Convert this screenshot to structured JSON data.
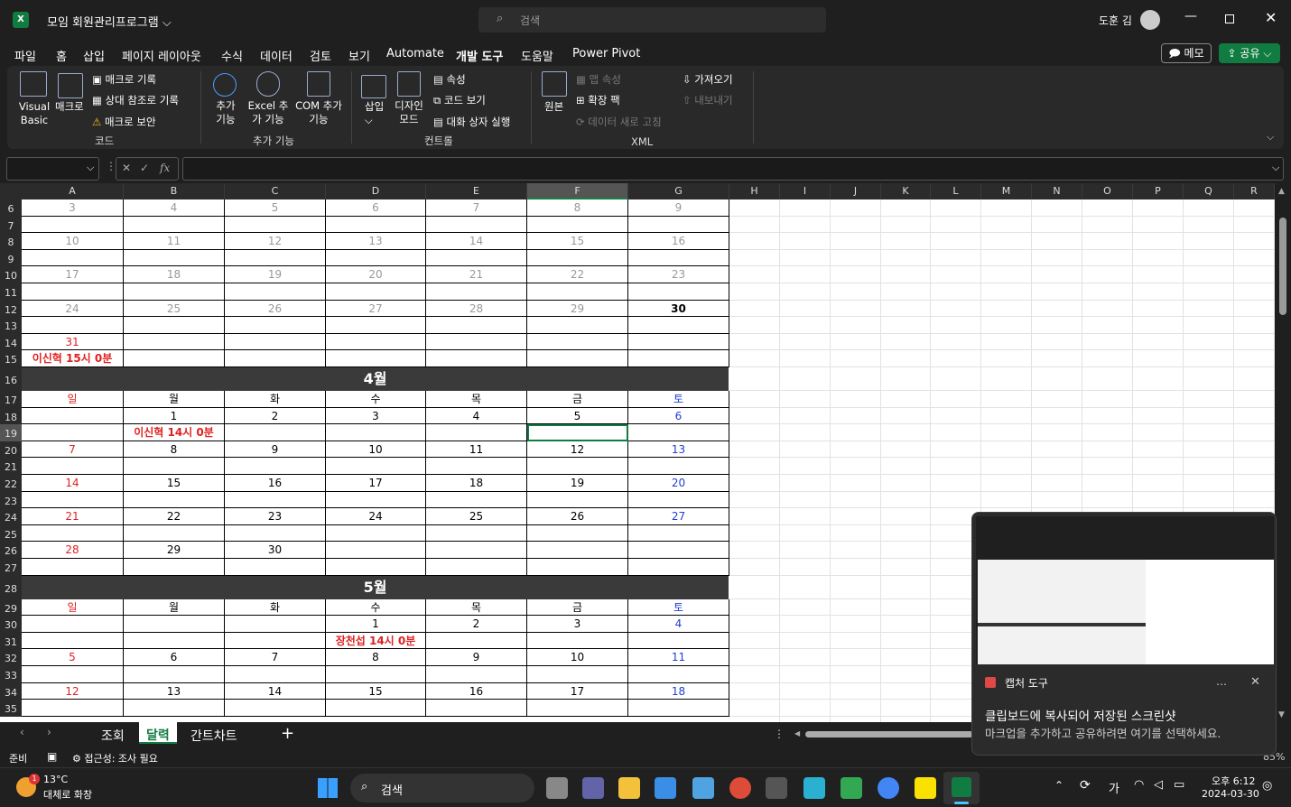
{
  "window": {
    "title": "모임 회원관리프로그램",
    "search_placeholder": "검색",
    "user_name": "도훈 김"
  },
  "menu_tabs": [
    "파일",
    "홈",
    "삽입",
    "페이지 레이아웃",
    "수식",
    "데이터",
    "검토",
    "보기",
    "Automate",
    "개발 도구",
    "도움말",
    "Power Pivot"
  ],
  "active_tab": "개발 도구",
  "memo_button": "메모",
  "share_button": "공유",
  "ribbon": {
    "code": {
      "visual_basic": "Visual Basic",
      "macro": "매크로",
      "record_macro": "매크로 기록",
      "relative_ref": "상대 참조로 기록",
      "macro_security": "매크로 보안",
      "group": "코드"
    },
    "addins": {
      "addin": "추가 기능",
      "excel_addin": "Excel 추가 기능",
      "com_addin": "COM 추가 기능",
      "group": "추가 기능"
    },
    "controls": {
      "insert": "삽입",
      "design_mode": "디자인 모드",
      "properties": "속성",
      "view_code": "코드 보기",
      "run_dialog": "대화 상자 실행",
      "group": "컨트롤"
    },
    "xml": {
      "source": "원본",
      "map_properties": "맵 속성",
      "expansion_packs": "확장 팩",
      "refresh_data": "데이터 새로 고침",
      "import": "가져오기",
      "export": "내보내기",
      "group": "XML"
    }
  },
  "formula_bar": {
    "fx": "fx"
  },
  "columns": [
    "A",
    "B",
    "C",
    "D",
    "E",
    "F",
    "G",
    "H",
    "I",
    "J",
    "K",
    "L",
    "M",
    "N",
    "O",
    "P",
    "Q",
    "R"
  ],
  "rows": [
    {
      "n": "6",
      "cells": [
        "3",
        "4",
        "5",
        "6",
        "7",
        "8",
        "9"
      ],
      "style": "gray"
    },
    {
      "n": "7",
      "cells": [
        "",
        "",
        "",
        "",
        "",
        "",
        ""
      ]
    },
    {
      "n": "8",
      "cells": [
        "10",
        "11",
        "12",
        "13",
        "14",
        "15",
        "16"
      ],
      "style": "gray"
    },
    {
      "n": "9",
      "cells": [
        "",
        "",
        "",
        "",
        "",
        "",
        ""
      ]
    },
    {
      "n": "10",
      "cells": [
        "17",
        "18",
        "19",
        "20",
        "21",
        "22",
        "23"
      ],
      "style": "gray"
    },
    {
      "n": "11",
      "cells": [
        "",
        "",
        "",
        "",
        "",
        "",
        ""
      ]
    },
    {
      "n": "12",
      "cells": [
        "24",
        "25",
        "26",
        "27",
        "28",
        "29",
        "30"
      ],
      "style": "gray"
    },
    {
      "n": "13",
      "cells": [
        "",
        "",
        "",
        "",
        "",
        "",
        ""
      ]
    },
    {
      "n": "14",
      "cells": [
        "31",
        "",
        "",
        "",
        "",
        "",
        ""
      ]
    },
    {
      "n": "15",
      "cells": [
        "이신혁 15시 0분",
        "",
        "",
        "",
        "",
        "",
        ""
      ]
    },
    {
      "n": "16",
      "cells": [
        "4월"
      ],
      "style": "month"
    },
    {
      "n": "17",
      "cells": [
        "일",
        "월",
        "화",
        "수",
        "목",
        "금",
        "토"
      ],
      "style": "days"
    },
    {
      "n": "18",
      "cells": [
        "",
        "1",
        "2",
        "3",
        "4",
        "5",
        "6"
      ]
    },
    {
      "n": "19",
      "cells": [
        "",
        "이신혁 14시 0분",
        "",
        "",
        "",
        "",
        ""
      ]
    },
    {
      "n": "20",
      "cells": [
        "7",
        "8",
        "9",
        "10",
        "11",
        "12",
        "13"
      ]
    },
    {
      "n": "21",
      "cells": [
        "",
        "",
        "",
        "",
        "",
        "",
        ""
      ]
    },
    {
      "n": "22",
      "cells": [
        "14",
        "15",
        "16",
        "17",
        "18",
        "19",
        "20"
      ]
    },
    {
      "n": "23",
      "cells": [
        "",
        "",
        "",
        "",
        "",
        "",
        ""
      ]
    },
    {
      "n": "24",
      "cells": [
        "21",
        "22",
        "23",
        "24",
        "25",
        "26",
        "27"
      ]
    },
    {
      "n": "25",
      "cells": [
        "",
        "",
        "",
        "",
        "",
        "",
        ""
      ]
    },
    {
      "n": "26",
      "cells": [
        "28",
        "29",
        "30",
        "",
        "",
        "",
        ""
      ]
    },
    {
      "n": "27",
      "cells": [
        "",
        "",
        "",
        "",
        "",
        "",
        ""
      ]
    },
    {
      "n": "28",
      "cells": [
        "5월"
      ],
      "style": "month"
    },
    {
      "n": "29",
      "cells": [
        "일",
        "월",
        "화",
        "수",
        "목",
        "금",
        "토"
      ],
      "style": "days"
    },
    {
      "n": "30",
      "cells": [
        "",
        "",
        "",
        "1",
        "2",
        "3",
        "4"
      ]
    },
    {
      "n": "31",
      "cells": [
        "",
        "",
        "",
        "장천섭 14시 0분",
        "",
        "",
        ""
      ]
    },
    {
      "n": "32",
      "cells": [
        "5",
        "6",
        "7",
        "8",
        "9",
        "10",
        "11"
      ]
    },
    {
      "n": "33",
      "cells": [
        "",
        "",
        "",
        "",
        "",
        "",
        ""
      ]
    },
    {
      "n": "34",
      "cells": [
        "12",
        "13",
        "14",
        "15",
        "16",
        "17",
        "18"
      ]
    },
    {
      "n": "35",
      "cells": [
        "",
        "",
        "",
        "",
        "",
        "",
        ""
      ]
    }
  ],
  "sheet_tabs": [
    "조회",
    "달력",
    "간트차트"
  ],
  "active_sheet": "달력",
  "status": {
    "ready": "준비",
    "accessibility": "접근성: 조사 필요",
    "zoom": "85%"
  },
  "toast": {
    "app": "캡처 도구",
    "title": "클립보드에 복사되어 저장된 스크린샷",
    "body": "마크업을 추가하고 공유하려면 여기를 선택하세요."
  },
  "taskbar": {
    "weather_temp": "13°C",
    "weather_desc": "대체로 화창",
    "weather_badge": "1",
    "search": "검색",
    "ime": "가",
    "time": "오후 6:12",
    "date": "2024-03-30"
  },
  "colors": {
    "accent_green": "#107c41",
    "sunday_red": "#e02020",
    "saturday_blue": "#2040d0",
    "month_bar": "#3a3a3a"
  }
}
